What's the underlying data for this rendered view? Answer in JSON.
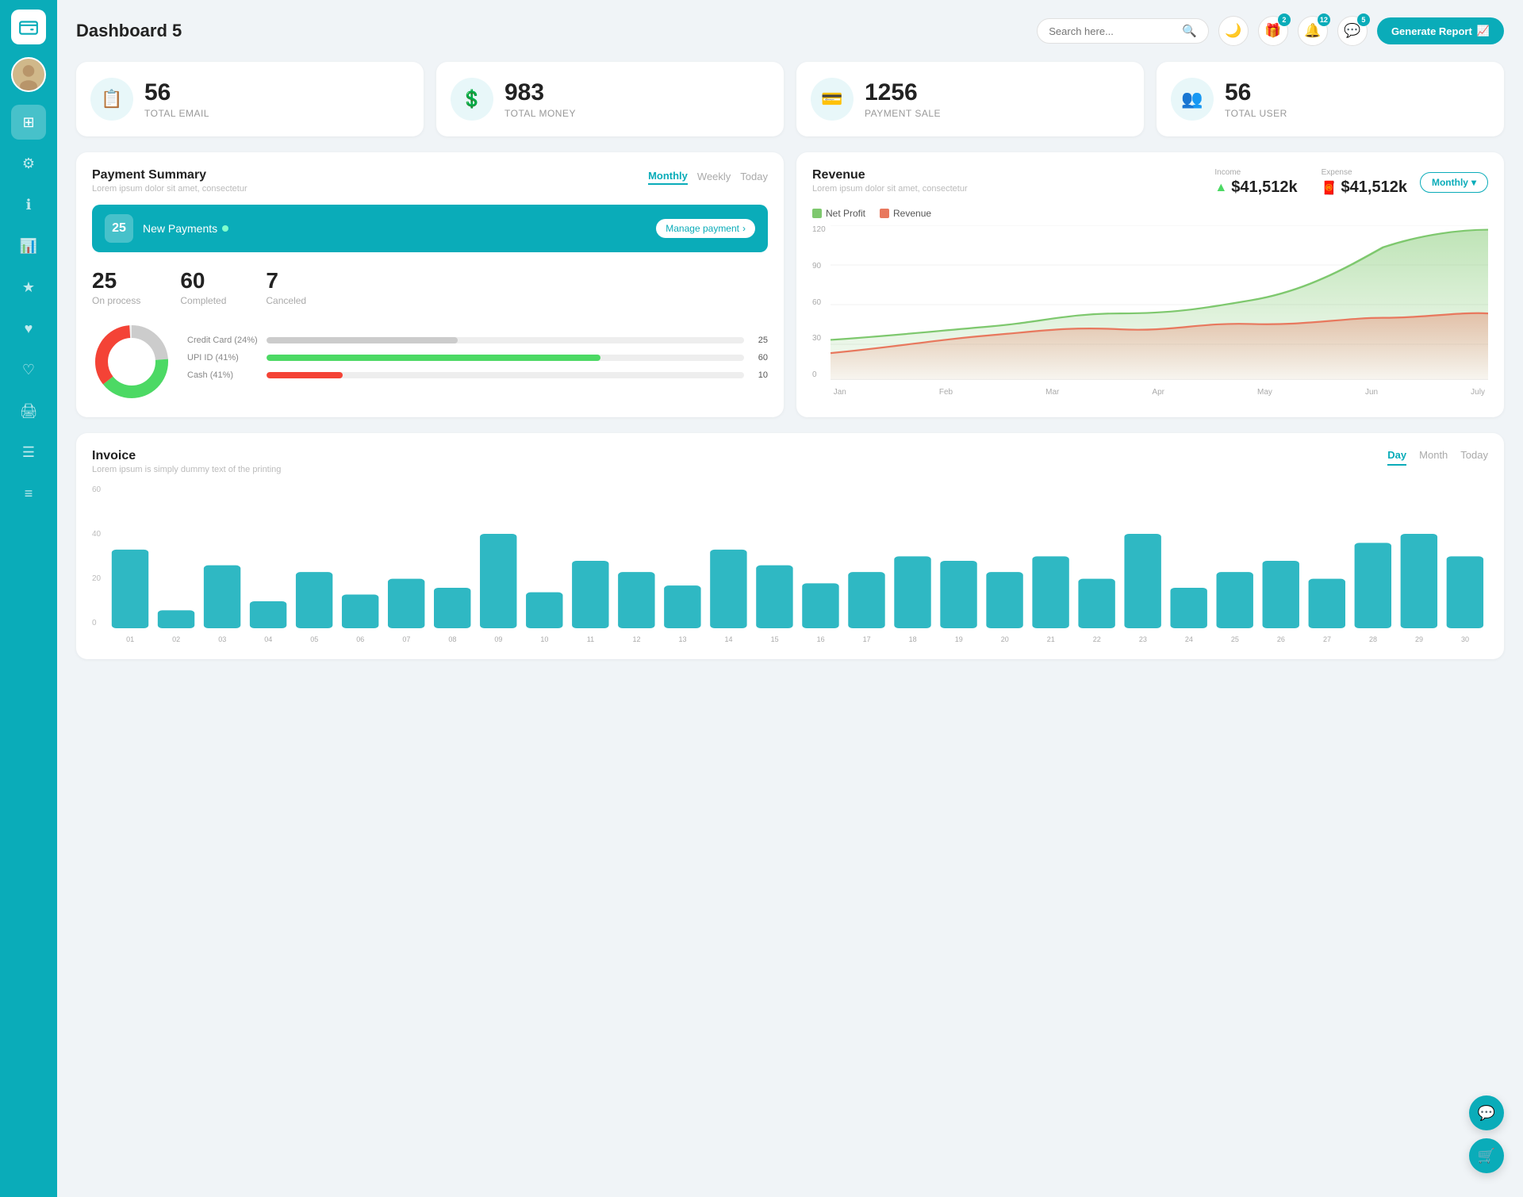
{
  "sidebar": {
    "logo_icon": "wallet",
    "items": [
      {
        "id": "grid",
        "icon": "⊞",
        "label": "dashboard",
        "active": true
      },
      {
        "id": "settings",
        "icon": "⚙",
        "label": "settings"
      },
      {
        "id": "info",
        "icon": "ℹ",
        "label": "info"
      },
      {
        "id": "chart",
        "icon": "📊",
        "label": "analytics"
      },
      {
        "id": "star",
        "icon": "★",
        "label": "favorites"
      },
      {
        "id": "heart",
        "icon": "♥",
        "label": "wishlist"
      },
      {
        "id": "heart2",
        "icon": "♡",
        "label": "likes"
      },
      {
        "id": "print",
        "icon": "🖨",
        "label": "print"
      },
      {
        "id": "menu",
        "icon": "☰",
        "label": "menu"
      },
      {
        "id": "list",
        "icon": "☰",
        "label": "list"
      }
    ]
  },
  "header": {
    "title": "Dashboard 5",
    "search_placeholder": "Search here...",
    "generate_btn": "Generate Report",
    "icons": {
      "gift_badge": "2",
      "bell_badge": "12",
      "chat_badge": "5"
    }
  },
  "stat_cards": [
    {
      "number": "56",
      "label": "TOTAL EMAIL",
      "icon": "📋"
    },
    {
      "number": "983",
      "label": "TOTAL MONEY",
      "icon": "💲"
    },
    {
      "number": "1256",
      "label": "PAYMENT SALE",
      "icon": "💳"
    },
    {
      "number": "56",
      "label": "TOTAL USER",
      "icon": "👥"
    }
  ],
  "payment_summary": {
    "title": "Payment Summary",
    "subtitle": "Lorem ipsum dolor sit amet, consectetur",
    "tabs": [
      "Monthly",
      "Weekly",
      "Today"
    ],
    "active_tab": "Monthly",
    "new_payments_count": "25",
    "new_payments_label": "New Payments",
    "manage_link": "Manage payment",
    "stats": [
      {
        "number": "25",
        "label": "On process"
      },
      {
        "number": "60",
        "label": "Completed"
      },
      {
        "number": "7",
        "label": "Canceled"
      }
    ],
    "payment_bars": [
      {
        "label": "Credit Card (24%)",
        "value": 25,
        "percent": 24,
        "color": "#ccc"
      },
      {
        "label": "UPI ID (41%)",
        "value": 60,
        "percent": 41,
        "color": "#4cd964"
      },
      {
        "label": "Cash (41%)",
        "value": 10,
        "percent": 10,
        "color": "#f44"
      }
    ],
    "donut": {
      "segments": [
        {
          "percent": 24,
          "color": "#ccc"
        },
        {
          "percent": 41,
          "color": "#4cd964"
        },
        {
          "percent": 35,
          "color": "#f44"
        }
      ]
    }
  },
  "revenue": {
    "title": "Revenue",
    "subtitle": "Lorem ipsum dolor sit amet, consectetur",
    "dropdown": "Monthly",
    "income_label": "Income",
    "income_value": "$41,512k",
    "expense_label": "Expense",
    "expense_value": "$41,512k",
    "legend": [
      {
        "label": "Net Profit",
        "color": "#7ec86e"
      },
      {
        "label": "Revenue",
        "color": "#e8785e"
      }
    ],
    "x_labels": [
      "Jan",
      "Feb",
      "Mar",
      "Apr",
      "May",
      "Jun",
      "July"
    ],
    "y_labels": [
      "120",
      "90",
      "60",
      "30",
      "0"
    ]
  },
  "invoice": {
    "title": "Invoice",
    "subtitle": "Lorem ipsum is simply dummy text of the printing",
    "tabs": [
      "Day",
      "Month",
      "Today"
    ],
    "active_tab": "Day",
    "y_labels": [
      "60",
      "40",
      "20",
      "0"
    ],
    "x_labels": [
      "01",
      "02",
      "03",
      "04",
      "05",
      "06",
      "07",
      "08",
      "09",
      "10",
      "11",
      "12",
      "13",
      "14",
      "15",
      "16",
      "17",
      "18",
      "19",
      "20",
      "21",
      "22",
      "23",
      "24",
      "25",
      "26",
      "27",
      "28",
      "29",
      "30"
    ],
    "bars": [
      35,
      8,
      28,
      12,
      25,
      15,
      22,
      18,
      42,
      16,
      30,
      25,
      19,
      35,
      28,
      20,
      25,
      32,
      30,
      25,
      32,
      22,
      42,
      18,
      25,
      30,
      22,
      38,
      42,
      32
    ]
  },
  "float_buttons": {
    "support": "💬",
    "cart": "🛒"
  }
}
